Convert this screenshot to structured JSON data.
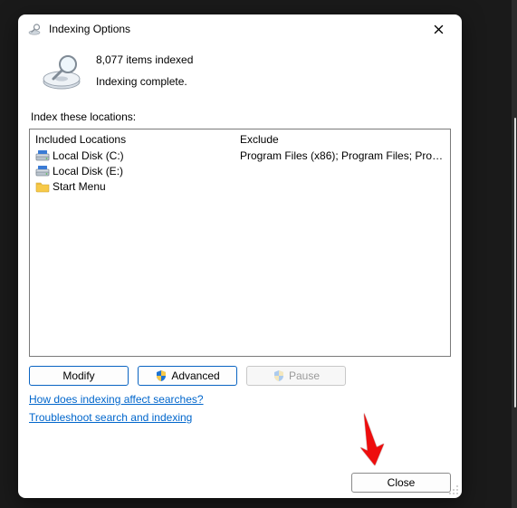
{
  "window": {
    "title": "Indexing Options"
  },
  "status": {
    "count_line": "8,077 items indexed",
    "status_line": "Indexing complete."
  },
  "section_label": "Index these locations:",
  "columns": {
    "included": "Included Locations",
    "exclude": "Exclude"
  },
  "locations": [
    {
      "icon": "drive",
      "name": "Local Disk (C:)",
      "exclude": "Program Files (x86); Program Files; Progra..."
    },
    {
      "icon": "drive",
      "name": "Local Disk (E:)",
      "exclude": ""
    },
    {
      "icon": "folder",
      "name": "Start Menu",
      "exclude": ""
    }
  ],
  "buttons": {
    "modify": "Modify",
    "advanced": "Advanced",
    "pause": "Pause",
    "close": "Close"
  },
  "links": {
    "how": "How does indexing affect searches?",
    "troubleshoot": "Troubleshoot search and indexing"
  }
}
